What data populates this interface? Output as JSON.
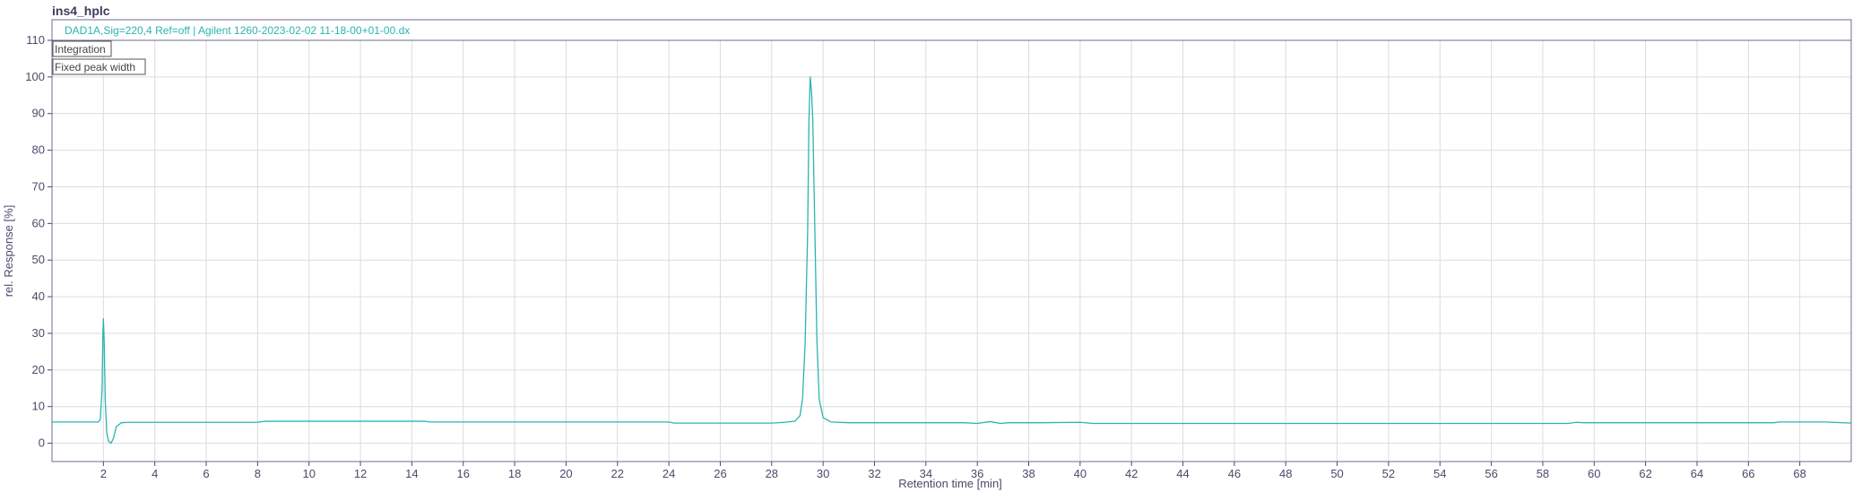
{
  "chart_data": {
    "type": "line",
    "title": "ins4_hplc",
    "legend": "DAD1A,Sig=220,4  Ref=off | Agilent 1260-2023-02-02 11-18-00+01-00.dx",
    "xlabel": "Retention time [min]",
    "ylabel": "rel. Response [%]",
    "xlim": [
      0,
      70
    ],
    "ylim": [
      -5,
      110
    ],
    "x_ticks": [
      2,
      4,
      6,
      8,
      10,
      12,
      14,
      16,
      18,
      20,
      22,
      24,
      26,
      28,
      30,
      32,
      34,
      36,
      38,
      40,
      42,
      44,
      46,
      48,
      50,
      52,
      54,
      56,
      58,
      60,
      62,
      64,
      66,
      68
    ],
    "y_ticks": [
      0,
      10,
      20,
      30,
      40,
      50,
      60,
      70,
      80,
      90,
      100,
      110
    ],
    "grid": true,
    "legend_position": "top",
    "colors": {
      "series": "#2ab5b0",
      "frame": "#6f6b95",
      "grid": "#dcdcdc",
      "text": "#4a4a6a"
    },
    "annotations": [
      "Integration",
      "Fixed peak width"
    ],
    "series": [
      {
        "name": "DAD1A,Sig=220,4  Ref=off | Agilent 1260-2023-02-02 11-18-00+01-00.dx",
        "x": [
          0,
          1.8,
          1.88,
          1.95,
          1.98,
          2.0,
          2.03,
          2.07,
          2.13,
          2.2,
          2.3,
          2.4,
          2.5,
          2.7,
          3.0,
          8.0,
          8.3,
          8.5,
          14.5,
          14.7,
          24.0,
          24.2,
          28.0,
          28.5,
          28.9,
          29.1,
          29.2,
          29.3,
          29.4,
          29.45,
          29.5,
          29.55,
          29.6,
          29.68,
          29.76,
          29.85,
          30.0,
          30.3,
          31.0,
          35.5,
          36.0,
          36.5,
          36.9,
          37.2,
          38.5,
          40.0,
          40.5,
          59.0,
          59.3,
          59.6,
          60.0,
          67.0,
          67.2,
          69.0,
          70.0
        ],
        "y": [
          5.8,
          5.8,
          6.5,
          15.0,
          30.0,
          34.0,
          28.0,
          12.0,
          3.0,
          0.5,
          0.0,
          1.5,
          4.5,
          5.6,
          5.7,
          5.7,
          6.0,
          6.0,
          6.0,
          5.8,
          5.8,
          5.5,
          5.5,
          5.7,
          6.0,
          7.5,
          12.0,
          27.0,
          58.0,
          88.0,
          100.0,
          96.0,
          88.0,
          58.0,
          28.0,
          12.0,
          7.0,
          5.8,
          5.6,
          5.6,
          5.4,
          5.9,
          5.4,
          5.6,
          5.6,
          5.7,
          5.4,
          5.4,
          5.7,
          5.6,
          5.6,
          5.6,
          5.8,
          5.8,
          5.5
        ]
      }
    ]
  }
}
